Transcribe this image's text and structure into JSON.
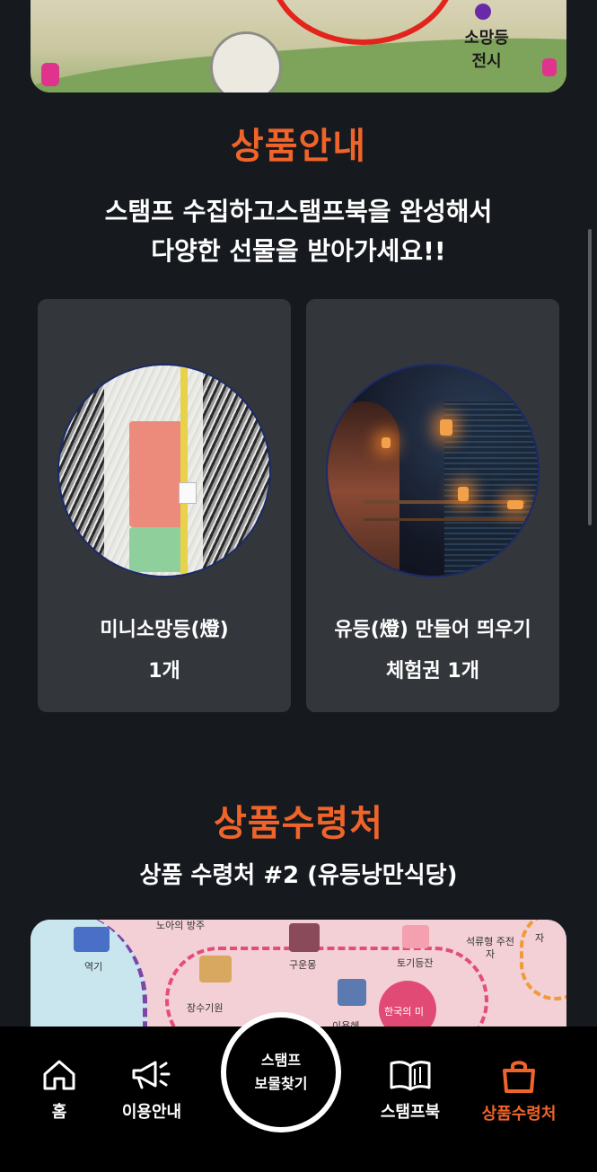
{
  "top_map": {
    "label_line1": "소망등",
    "label_line2": "전시"
  },
  "products": {
    "title": "상품안내",
    "subtitle_line1": "스탬프 수집하고스탬프북을 완성해서",
    "subtitle_line2": "다양한 선물을 받아가세요!!",
    "items": [
      {
        "name": "미니소망등(燈)",
        "qty": "1개"
      },
      {
        "name": "유등(燈) 만들어 띄우기",
        "qty": "체험권 1개"
      }
    ]
  },
  "pickup": {
    "title": "상품수령처",
    "subtitle": "상품 수령처 #2 (유등낭만식당)"
  },
  "bottom_map": {
    "labels": [
      "노아의 방주",
      "역기",
      "구운몽",
      "토기등잔",
      "석류형 주전자",
      "자",
      "장수기원",
      "이용혜",
      "한국의 미"
    ]
  },
  "nav": {
    "home": "홈",
    "guide": "이용안내",
    "center_line1": "스탬프",
    "center_line2": "보물찾기",
    "stampbook": "스탬프북",
    "pickup": "상품수령처",
    "active_color": "#f0642a"
  }
}
